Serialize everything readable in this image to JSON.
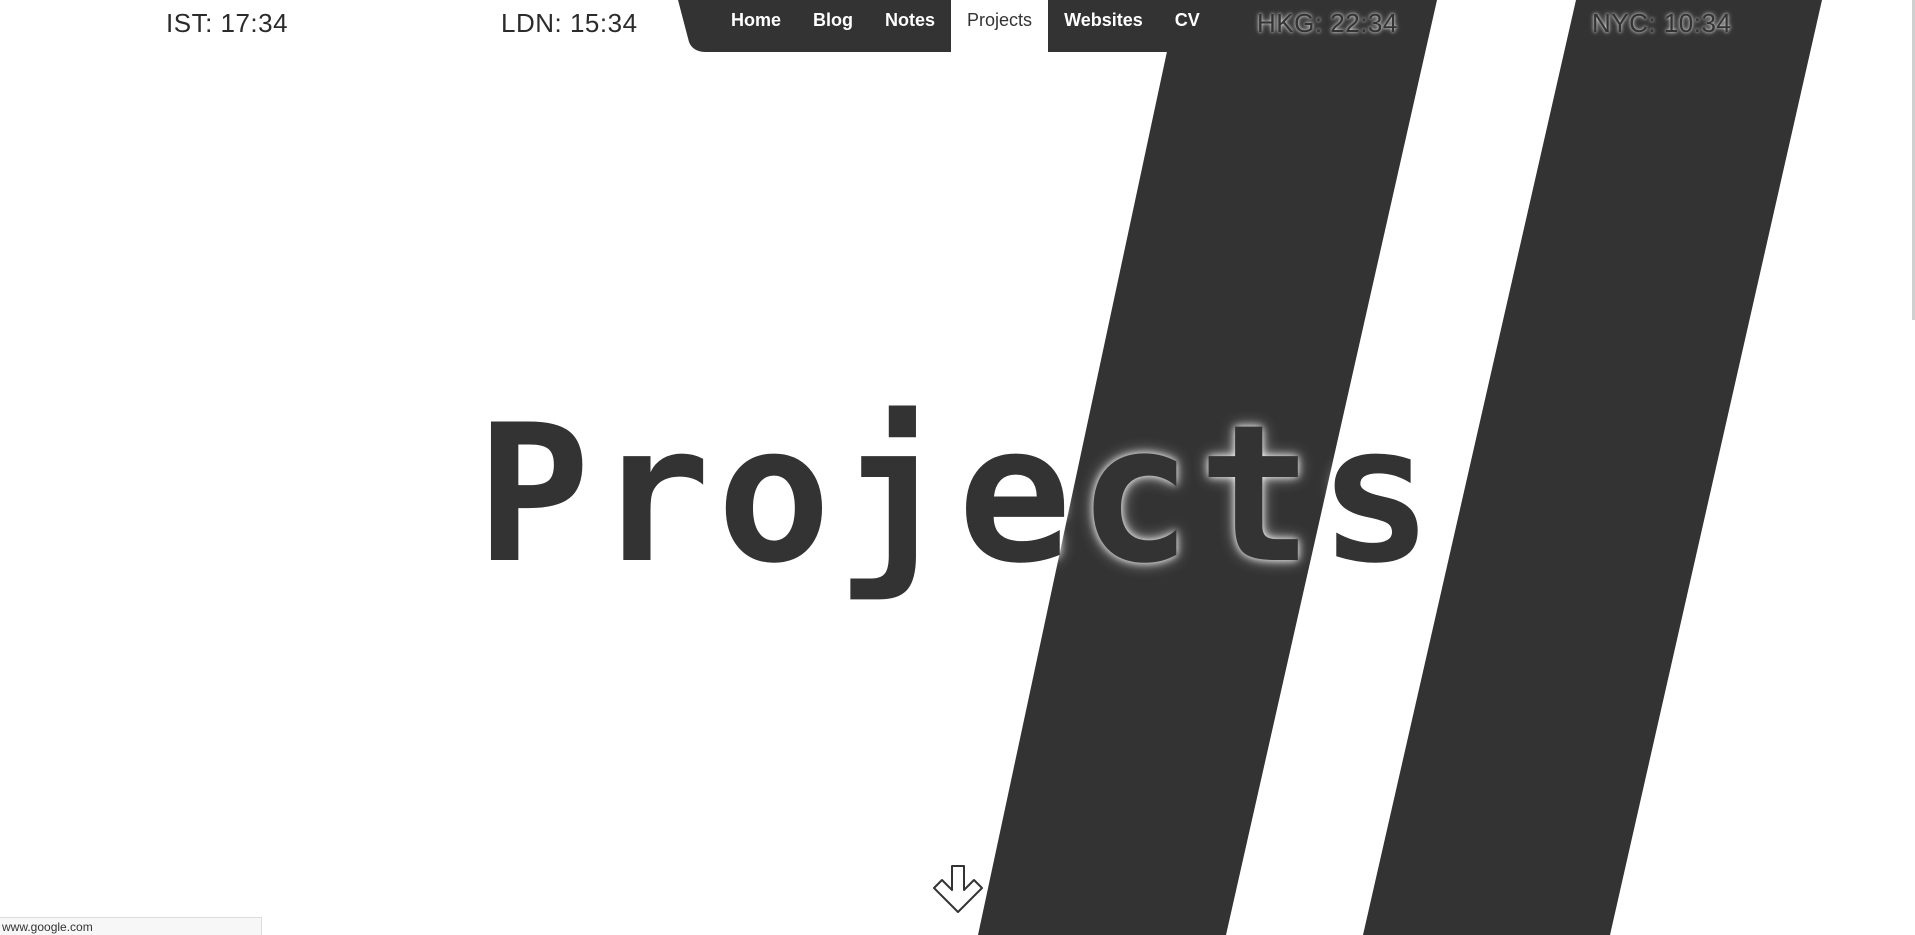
{
  "clocks": [
    {
      "label": "IST: 17:34"
    },
    {
      "label": "LDN: 15:34"
    },
    {
      "label": "HKG: 22:34"
    },
    {
      "label": "NYC: 10:34"
    }
  ],
  "nav": {
    "items": [
      {
        "label": "Home",
        "active": false
      },
      {
        "label": "Blog",
        "active": false
      },
      {
        "label": "Notes",
        "active": false
      },
      {
        "label": "Projects",
        "active": true
      },
      {
        "label": "Websites",
        "active": false
      },
      {
        "label": "CV",
        "active": false
      }
    ]
  },
  "hero": {
    "title": "Projects"
  },
  "status_bar": {
    "url": "www.google.com"
  },
  "icons": {
    "scroll_down": "arrow-down-icon"
  },
  "colors": {
    "dark": "#333333",
    "light": "#ffffff"
  }
}
